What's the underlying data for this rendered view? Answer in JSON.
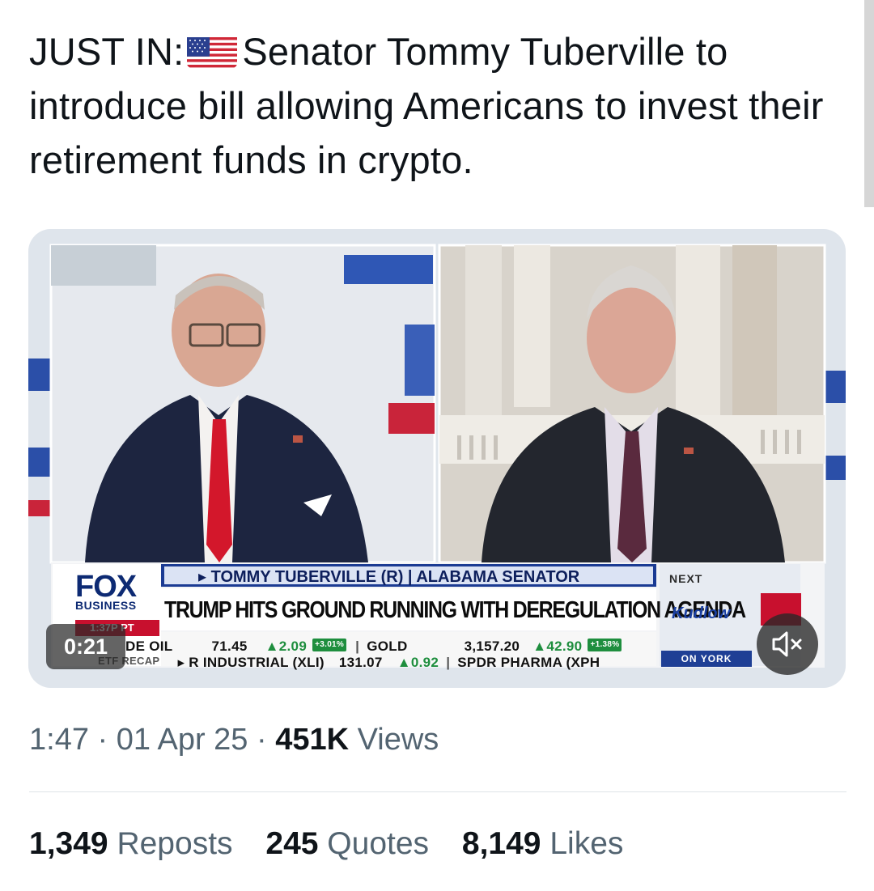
{
  "tweet": {
    "text_prefix": "JUST IN:",
    "text_body": "Senator Tommy Tuberville to introduce bill allowing Americans to invest their retirement funds in crypto.",
    "flag_icon": "us-flag-emoji"
  },
  "video": {
    "timer": "0:21",
    "mute_icon": "speaker-muted-icon",
    "broadcast": {
      "network": "FOX",
      "network_sub": "BUSINESS",
      "time": "1:37P PT",
      "name_line": "▸ TOMMY TUBERVILLE (R) | ALABAMA SENATOR",
      "headline": "TRUMP HITS GROUND RUNNING WITH DEREGULATION AGENDA",
      "next_label": "NEXT",
      "next_show": "Kudlow",
      "next_city": "ON YORK",
      "ticker_top": {
        "lead": "DE OIL",
        "price1": "71.45",
        "change1": "▲2.09",
        "pct1": "+3.01%",
        "name2": "GOLD",
        "price2": "3,157.20",
        "change2": "▲42.90",
        "pct2": "+1.38%"
      },
      "ticker_bottom": {
        "lead": "ETF RECAP",
        "name1": "▸ R INDUSTRIAL (XLI)",
        "price1": "131.07",
        "change1": "▲0.92",
        "name2": "SPDR PHARMA (XPH"
      }
    }
  },
  "meta": {
    "time": "1:47",
    "date": "01 Apr 25",
    "views_count": "451K",
    "views_label": "Views"
  },
  "stats": [
    {
      "count": "1,349",
      "label": "Reposts"
    },
    {
      "count": "245",
      "label": "Quotes"
    },
    {
      "count": "8,149",
      "label": "Likes"
    }
  ],
  "colors": {
    "text_primary": "#0f1419",
    "text_secondary": "#536471",
    "fox_navy": "#0d2a73",
    "fox_red": "#c8102e"
  }
}
